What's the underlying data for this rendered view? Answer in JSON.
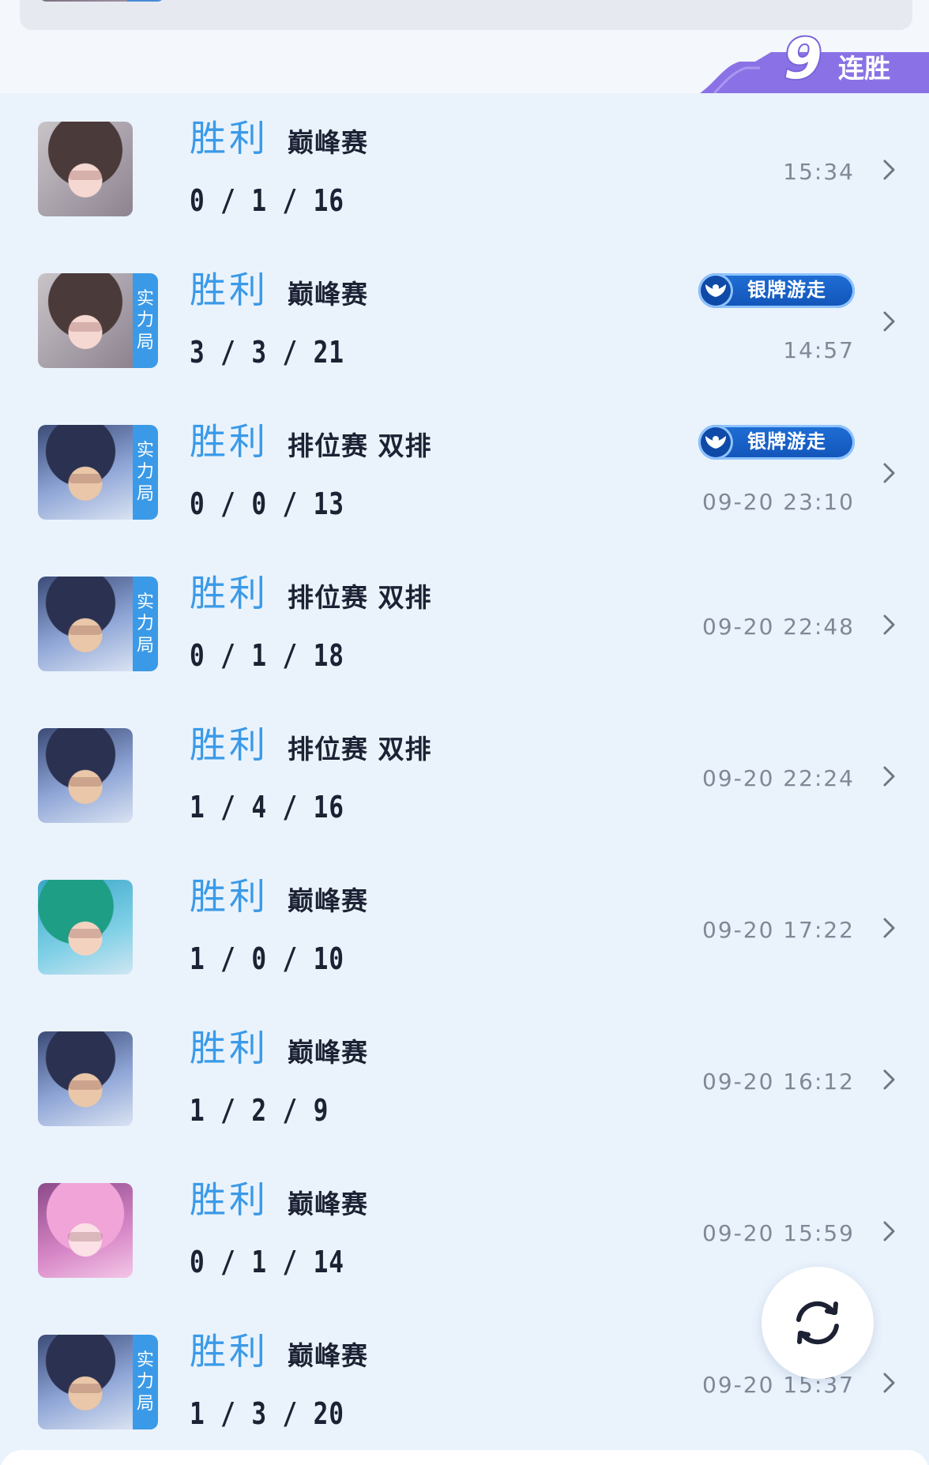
{
  "streak": {
    "count": "9",
    "label": "连胜"
  },
  "matches": [
    {
      "result": "胜利",
      "mode": "巅峰赛",
      "kda": "0 / 1 / 16",
      "time": "15:34",
      "avatar": "pink-hair",
      "tag": null,
      "badge": null
    },
    {
      "result": "胜利",
      "mode": "巅峰赛",
      "kda": "3 / 3 / 21",
      "time": "14:57",
      "avatar": "pink-hair",
      "tag": [
        "实",
        "力",
        "局"
      ],
      "badge": "银牌游走"
    },
    {
      "result": "胜利",
      "mode": "排位赛 双排",
      "kda": "0 / 0 / 13",
      "time": "09-20 23:10",
      "avatar": "dark-hero",
      "tag": [
        "实",
        "力",
        "局"
      ],
      "badge": "银牌游走"
    },
    {
      "result": "胜利",
      "mode": "排位赛 双排",
      "kda": "0 / 1 / 18",
      "time": "09-20 22:48",
      "avatar": "dark-hero",
      "tag": [
        "实",
        "力",
        "局"
      ],
      "badge": null
    },
    {
      "result": "胜利",
      "mode": "排位赛 双排",
      "kda": "1 / 4 / 16",
      "time": "09-20 22:24",
      "avatar": "dark-hero",
      "tag": null,
      "badge": null
    },
    {
      "result": "胜利",
      "mode": "巅峰赛",
      "kda": "1 / 0 / 10",
      "time": "09-20 17:22",
      "avatar": "green-hero",
      "tag": null,
      "badge": null
    },
    {
      "result": "胜利",
      "mode": "巅峰赛",
      "kda": "1 / 2 / 9",
      "time": "09-20 16:12",
      "avatar": "dark-hero",
      "tag": null,
      "badge": null
    },
    {
      "result": "胜利",
      "mode": "巅峰赛",
      "kda": "0 / 1 / 14",
      "time": "09-20 15:59",
      "avatar": "pink-girl",
      "tag": null,
      "badge": null
    },
    {
      "result": "胜利",
      "mode": "巅峰赛",
      "kda": "1 / 3 / 20",
      "time": "09-20 15:37",
      "avatar": "dark-hero",
      "tag": [
        "实",
        "力",
        "局"
      ],
      "badge": null
    }
  ],
  "icons": {
    "chevron": "chevron-right-icon",
    "refresh": "refresh-icon",
    "badge_emblem": "wings-emblem-icon"
  },
  "colors": {
    "accent_blue": "#3b9ae8",
    "streak_purple": "#8a72e6",
    "badge_blue": "#1a63c9",
    "time_gray": "#7f8896"
  }
}
